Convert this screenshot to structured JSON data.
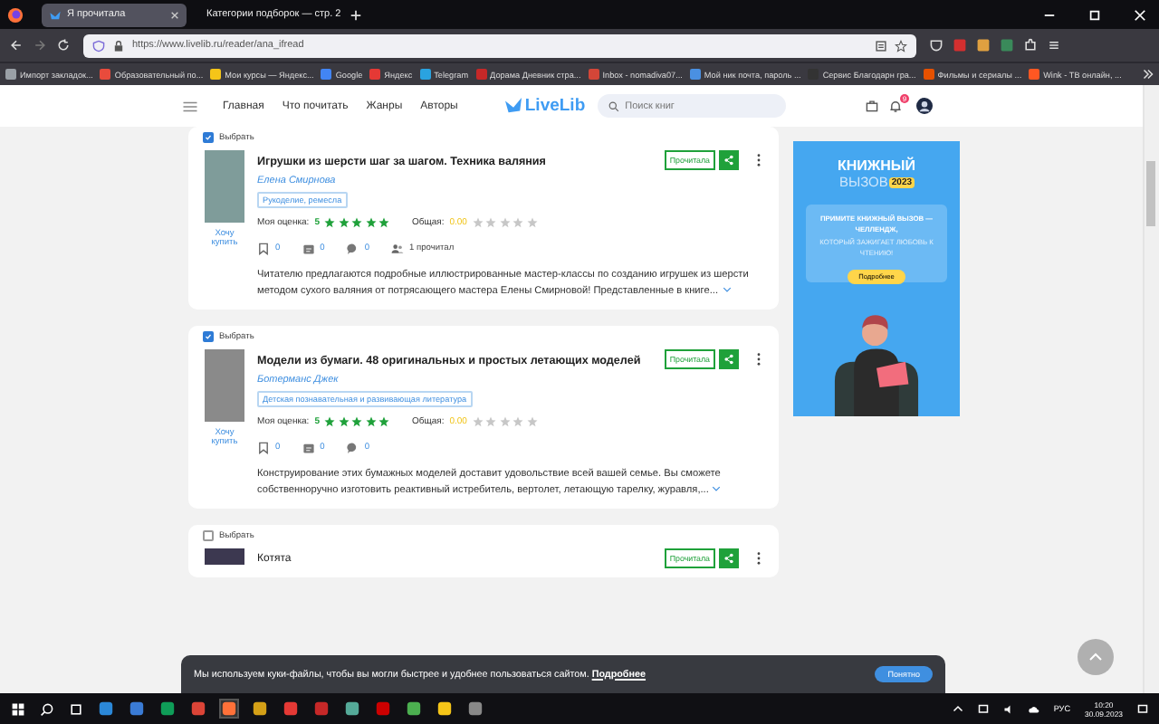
{
  "browser": {
    "tabs": [
      {
        "title": "Я прочитала",
        "selected": true
      },
      {
        "title": "Категории подборок — стр. 2",
        "selected": false
      }
    ],
    "address": "https://www.livelib.ru/reader/ana_ifread",
    "bookmarks": [
      "Импорт закладок...",
      "Образовательный по...",
      "Мои курсы — Яндекс...",
      "Google",
      "Яндекс",
      "Telegram",
      "Дорама Дневник стра...",
      "Inbox - nomadiva07...",
      "Мой ник почта, пароль ...",
      "Сервис Благодарн гра...",
      "Фильмы и сериалы ...",
      "Wink - ТВ онлайн, ..."
    ]
  },
  "site_header": {
    "nav": [
      "Главная",
      "Что почитать",
      "Жанры",
      "Авторы"
    ],
    "logo": "LiveLib",
    "search_placeholder": "Поиск книг",
    "notification_count": "9"
  },
  "cards": [
    {
      "selected": true,
      "select_label": "Выбрать",
      "title": "Игрушки из шерсти шаг за шагом. Техника валяния",
      "author": "Елена Смирнова",
      "genre": "Рукоделие, ремесла",
      "want_label": "Хочу купить",
      "my_rating_label": "Моя оценка:",
      "my_rating": "5",
      "stars": 5,
      "overall_label": "Общая:",
      "overall": "0.00",
      "read_button": "Прочитала",
      "counts": [
        {
          "kind": "bookmark",
          "value": "0"
        },
        {
          "kind": "quote",
          "value": "0"
        },
        {
          "kind": "comment",
          "value": "0"
        },
        {
          "kind": "readers",
          "value": "1 прочитал"
        }
      ],
      "description": "Читателю предлагаются подробные иллюстрированные мастер-классы по созданию игрушек из шерсти методом сухого валяния от потрясающего мастера Елены Смирновой! Представленные в книге..."
    },
    {
      "selected": true,
      "select_label": "Выбрать",
      "title": "Модели из бумаги. 48 оригинальных и простых летающих моделей",
      "author": "Ботерманс Джек",
      "genre": "Детская познавательная и развивающая литература",
      "want_label": "Хочу купить",
      "my_rating_label": "Моя оценка:",
      "my_rating": "5",
      "stars": 5,
      "overall_label": "Общая:",
      "overall": "0.00",
      "read_button": "Прочитала",
      "counts": [
        {
          "kind": "bookmark",
          "value": "0"
        },
        {
          "kind": "quote",
          "value": "0"
        },
        {
          "kind": "comment",
          "value": "0"
        }
      ],
      "description": "Конструирование этих бумажных моделей доставит удовольствие всей вашей семье. Вы сможете собственноручно изготовить реактивный истребитель, вертолет, летающую тарелку, журавля,..."
    },
    {
      "selected": false,
      "select_label": "Выбрать",
      "title": "Котята",
      "read_button": "Прочитала"
    }
  ],
  "ad": {
    "title": "КНИЖНЫЙ",
    "subtitle": "ВЫЗОВ",
    "year": "2023",
    "text_bold": "ПРИМИТЕ КНИЖНЫЙ ВЫЗОВ — ЧЕЛЛЕНДЖ,",
    "text": "КОТОРЫЙ ЗАЖИГАЕТ ЛЮБОВЬ К ЧТЕНИЮ!",
    "button": "Подробнее"
  },
  "cookie_bar": {
    "text": "Мы используем куки-файлы, чтобы вы могли быстрее и удобнее пользоваться сайтом.",
    "link": "Подробнее",
    "button": "Понятно"
  },
  "taskbar": {
    "language": "РУС",
    "time": "10:20",
    "date": "30.09.2023"
  }
}
